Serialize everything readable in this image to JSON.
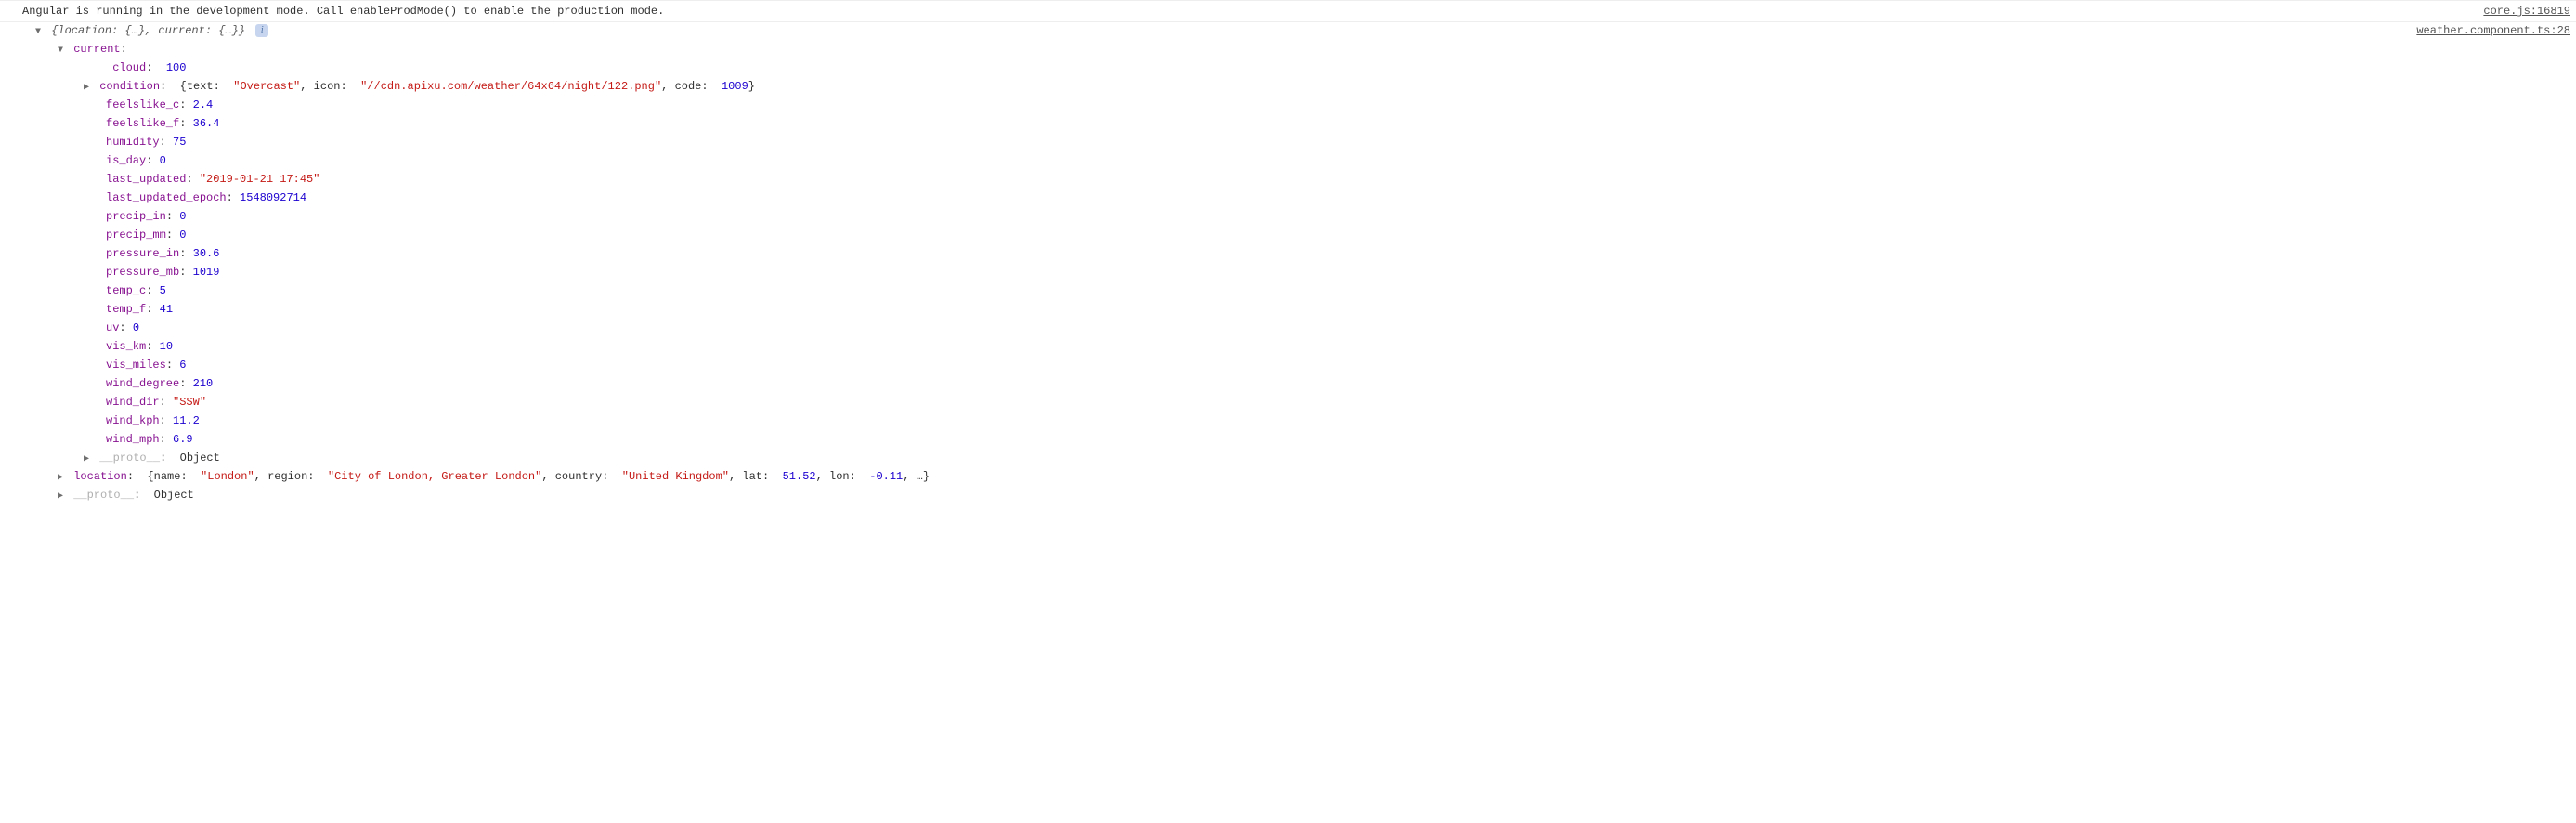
{
  "topMessage": {
    "text": "Angular is running in the development mode. Call enableProdMode() to enable the production mode.",
    "source": "core.js:16819"
  },
  "objectSummary": {
    "text": "{location: {…}, current: {…}}",
    "source": "weather.component.ts:28"
  },
  "currentKey": "current",
  "cloud": {
    "k": "cloud",
    "v": "100"
  },
  "condition": {
    "k": "condition",
    "textK": "text",
    "textV": "\"Overcast\"",
    "iconK": "icon",
    "iconV": "\"//cdn.apixu.com/weather/64x64/night/122.png\"",
    "codeK": "code",
    "codeV": "1009"
  },
  "feelslike_c": {
    "k": "feelslike_c",
    "v": "2.4"
  },
  "feelslike_f": {
    "k": "feelslike_f",
    "v": "36.4"
  },
  "humidity": {
    "k": "humidity",
    "v": "75"
  },
  "is_day": {
    "k": "is_day",
    "v": "0"
  },
  "last_updated": {
    "k": "last_updated",
    "v": "\"2019-01-21 17:45\""
  },
  "last_updated_epoch": {
    "k": "last_updated_epoch",
    "v": "1548092714"
  },
  "precip_in": {
    "k": "precip_in",
    "v": "0"
  },
  "precip_mm": {
    "k": "precip_mm",
    "v": "0"
  },
  "pressure_in": {
    "k": "pressure_in",
    "v": "30.6"
  },
  "pressure_mb": {
    "k": "pressure_mb",
    "v": "1019"
  },
  "temp_c": {
    "k": "temp_c",
    "v": "5"
  },
  "temp_f": {
    "k": "temp_f",
    "v": "41"
  },
  "uv": {
    "k": "uv",
    "v": "0"
  },
  "vis_km": {
    "k": "vis_km",
    "v": "10"
  },
  "vis_miles": {
    "k": "vis_miles",
    "v": "6"
  },
  "wind_degree": {
    "k": "wind_degree",
    "v": "210"
  },
  "wind_dir": {
    "k": "wind_dir",
    "v": "\"SSW\""
  },
  "wind_kph": {
    "k": "wind_kph",
    "v": "11.2"
  },
  "wind_mph": {
    "k": "wind_mph",
    "v": "6.9"
  },
  "proto": {
    "k": "__proto__",
    "v": "Object"
  },
  "location": {
    "k": "location",
    "nameK": "name",
    "nameV": "\"London\"",
    "regionK": "region",
    "regionV": "\"City of London, Greater London\"",
    "countryK": "country",
    "countryV": "\"United Kingdom\"",
    "latK": "lat",
    "latV": "51.52",
    "lonK": "lon",
    "lonV": "-0.11",
    "ell": "…"
  },
  "glyph": {
    "down": "▼",
    "right": "▶"
  },
  "info": "i",
  "punct": {
    "colon": ":",
    "comma": ", ",
    "lb": "{",
    "rb": "}"
  }
}
